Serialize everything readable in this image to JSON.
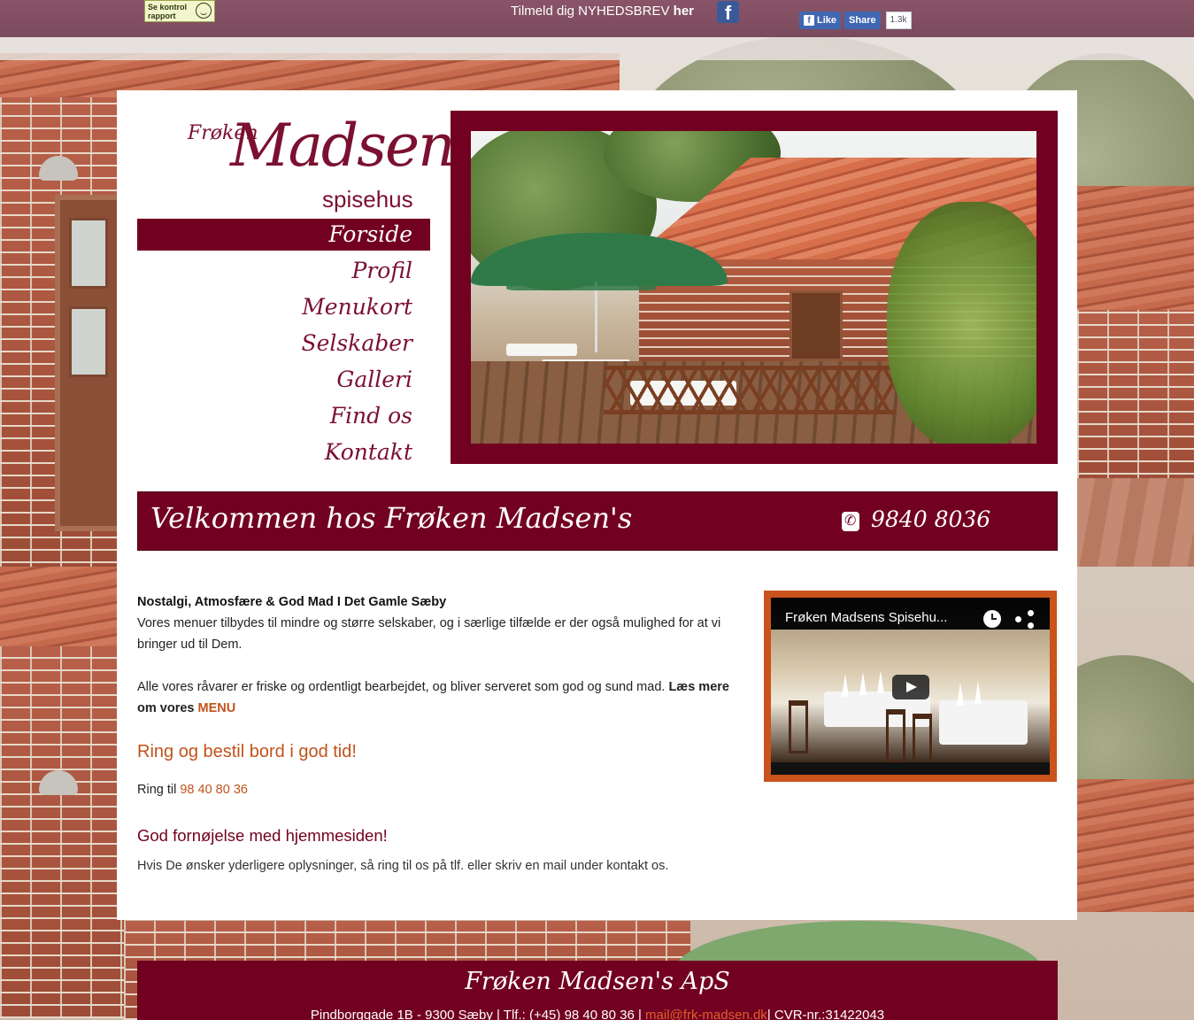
{
  "topbar": {
    "badge_text": "Se kontrol rapport",
    "newsletter_text": "Tilmeld dig NYHEDSBREV",
    "newsletter_link": "her",
    "facebook_icon": "facebook-icon",
    "like_label": "Like",
    "share_label": "Share",
    "share_count": "1.3k"
  },
  "logo": {
    "prefix": "Frøken",
    "name": "Madsen's",
    "suffix": "spisehus"
  },
  "nav": {
    "items": [
      {
        "label": "Forside",
        "active": true
      },
      {
        "label": "Profil"
      },
      {
        "label": "Menukort"
      },
      {
        "label": "Selskaber"
      },
      {
        "label": "Galleri"
      },
      {
        "label": "Find os"
      },
      {
        "label": "Kontakt"
      }
    ]
  },
  "welcome": {
    "title": "Velkommen hos Frøken Madsen's",
    "phone_icon": "phone-icon",
    "phone": "9840 8036"
  },
  "content": {
    "heading": "Nostalgi, Atmosfære & God Mad I Det Gamle Sæby",
    "para1": "Vores menuer tilbydes til mindre og større selskaber, og i særlige tilfælde er der også mulighed for at vi bringer ud til Dem.",
    "para2": "Alle vores råvarer er friske og ordentligt bearbejdet, og bliver serveret som god og sund mad.",
    "read_more": "Læs mere om vores",
    "menu_link": "MENU",
    "cta": "Ring og bestil bord i god tid!",
    "ring_label": "Ring til",
    "ring_number": "98 40 80 36",
    "enjoy": "God fornøjelse med hjemmesiden!",
    "info": "Hvis De ønsker yderligere oplysninger, så ring til os på tlf. eller skriv en mail under kontakt os."
  },
  "video": {
    "title": "Frøken Madsens Spisehu..."
  },
  "footer": {
    "name": "Frøken Madsen's ApS",
    "address": "Pindborggade 1B - 9300 Sæby | Tlf.: (+45) 98 40 80 36 |",
    "email": "mail@frk-madsen.dk",
    "cvr": "| CVR-nr.:31422043"
  },
  "colors": {
    "brand": "#720021",
    "accent": "#c0531b",
    "facebook": "#3b5998"
  }
}
